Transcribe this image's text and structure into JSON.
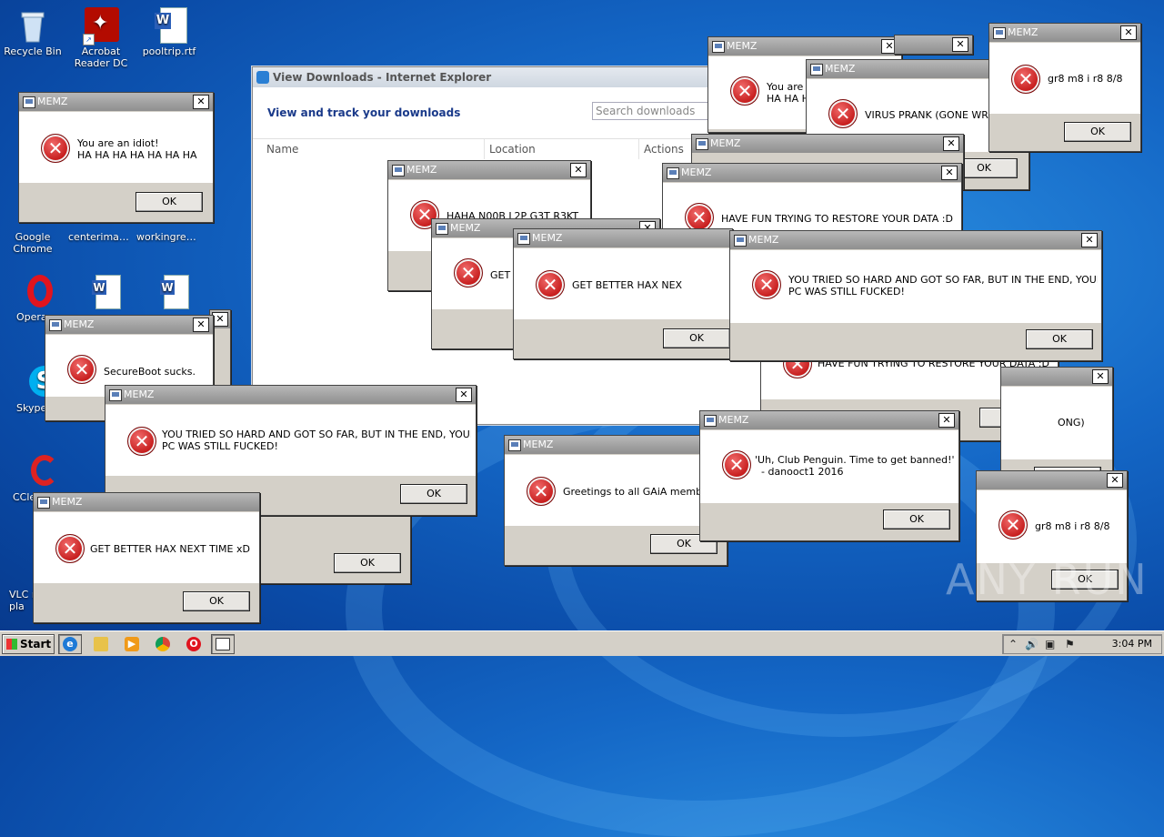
{
  "desktop": {
    "icons": [
      {
        "label": "Recycle Bin"
      },
      {
        "label": "Acrobat\nReader DC"
      },
      {
        "label": "pooltrip.rtf"
      },
      {
        "label": "Google\nChrome"
      },
      {
        "label": "centerimag..."
      },
      {
        "label": "workingrepl..."
      },
      {
        "label": "Opera"
      },
      {
        "label": "Skype"
      },
      {
        "label": "CCle"
      },
      {
        "label": "VLC m\npla"
      }
    ]
  },
  "ie_window": {
    "title": "View Downloads - Internet Explorer",
    "header": "View and track your downloads",
    "search_placeholder": "Search downloads",
    "columns": [
      "Name",
      "Location",
      "Actions"
    ]
  },
  "dialogs": [
    {
      "title": "MEMZ",
      "message": "You are an idiot!\nHA HA HA HA HA HA HA",
      "ok": "OK"
    },
    {
      "title": "MEMZ",
      "message": "SecureBoot sucks.",
      "ok": "OK"
    },
    {
      "title": "MEMZ",
      "message": "YOU TRIED SO HARD AND GOT SO FAR, BUT IN THE END, YOUR\nPC WAS STILL FUCKED!",
      "ok": "OK"
    },
    {
      "title": "MEMZ",
      "message": "GET BETTER HAX NEXT TIME xD",
      "ok": "OK"
    },
    {
      "title": "MEMZ",
      "message": "HAHA N00B L2P G3T R3KT",
      "ok": "OK"
    },
    {
      "title": "MEMZ",
      "message": "GET B",
      "ok": "OK"
    },
    {
      "title": "MEMZ",
      "message": "GET BETTER HAX NEX",
      "ok": "OK"
    },
    {
      "title": "MEMZ",
      "message": "Greetings to all GAiA members!",
      "ok": "OK"
    },
    {
      "title": "MEMZ",
      "message": "'Uh, Club Penguin. Time to get banned!'\n  - danooct1 2016",
      "ok": "OK"
    },
    {
      "title": "MEMZ",
      "message": "You are a\nHA HA HA",
      "ok": "OK"
    },
    {
      "title": "MEMZ",
      "message": "VIRUS PRANK (GONE WRONG)",
      "ok": "OK"
    },
    {
      "title": "MEMZ",
      "message": "gr8 m8 i r8 8/8",
      "ok": "OK"
    },
    {
      "title": "MEMZ",
      "message": "HAVE FUN TRYING TO RESTORE YOUR DATA :D",
      "ok": "OK"
    },
    {
      "title": "MEMZ",
      "message": "YOU TRIED SO HARD AND GOT SO FAR, BUT IN THE END, YOUR\nPC WAS STILL FUCKED!",
      "ok": "OK"
    },
    {
      "title": "MEMZ",
      "message": "HAVE FUN TRYING TO RESTORE YOUR DATA :D",
      "ok": "OK"
    },
    {
      "title": "MEMZ",
      "message": "ONG)",
      "ok": "OK"
    },
    {
      "title": "MEMZ",
      "message": "gr8 m8 i r8 8/8",
      "ok": "OK"
    }
  ],
  "taskbar": {
    "start_label": "Start",
    "clock": "3:04 PM"
  },
  "watermark": "ANY RUN"
}
